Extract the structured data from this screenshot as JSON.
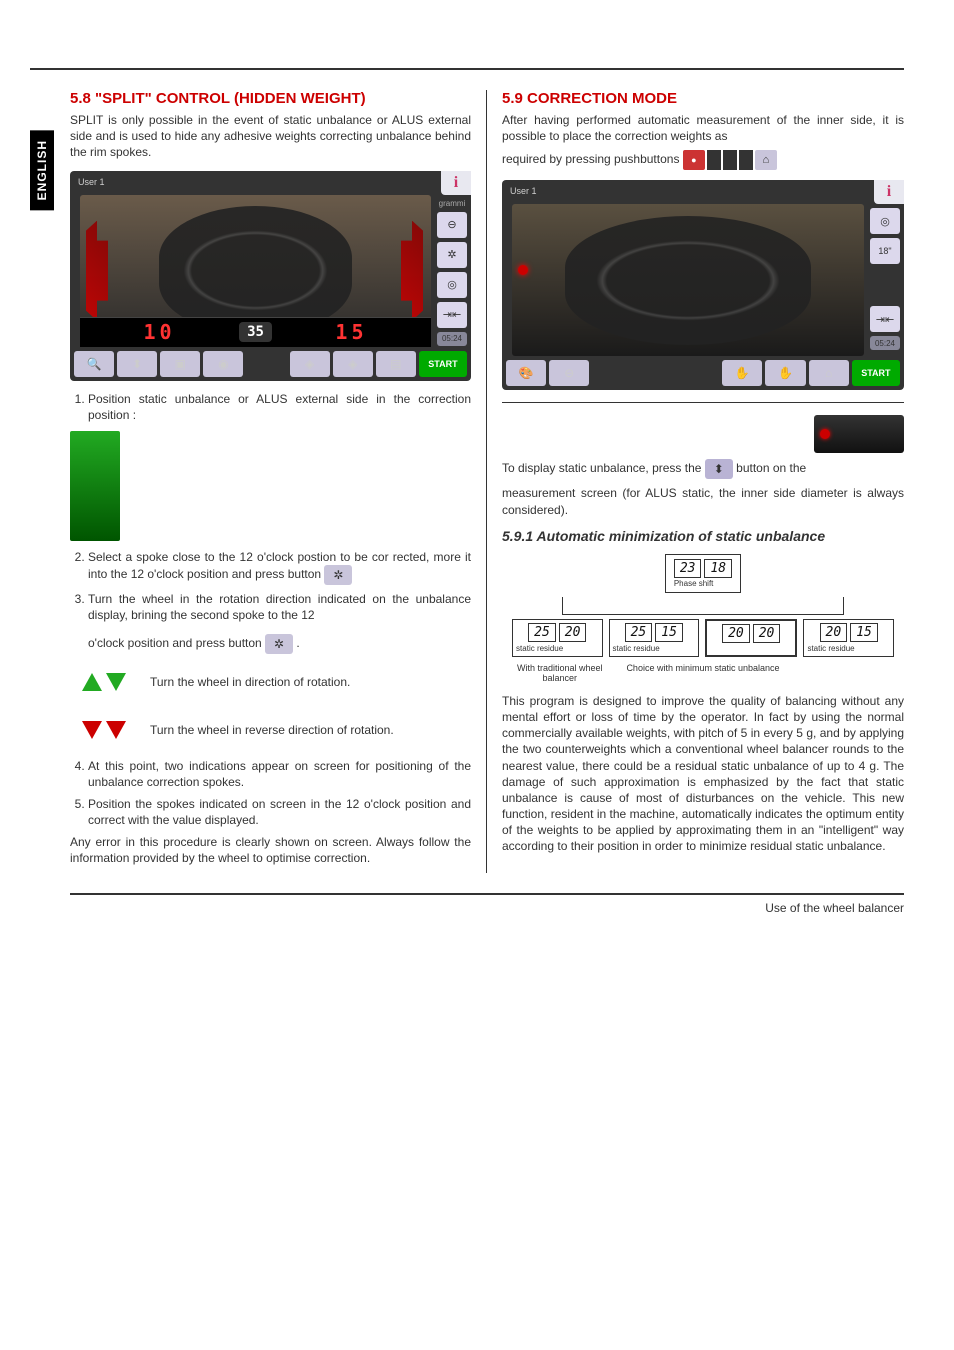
{
  "side_tab": "ENGLISH",
  "left": {
    "h2": "5.8    \"SPLIT\" CONTROL (HIDDEN WEIGHT)",
    "intro": "SPLIT is only possible in the event of static unbalance or ALUS external side and is used to hide any adhesive weights correcting unbalance behind the rim spokes.",
    "screen": {
      "user": "User 1",
      "info": "i",
      "side_label": "grammi",
      "val_left": "10",
      "val_mid": "35",
      "val_right": "15",
      "clock": "05:24",
      "start": "START"
    },
    "step1": "Position static unbalance or ALUS external side in the correction position :",
    "step2": "Select a spoke close to the 12 o'clock postion to be cor rected, more it into the 12 o'clock position and press button",
    "step3a": "Turn the wheel in the rotation direction indicated on the unbalance display, brining the second spoke to the 12",
    "step3b": "o'clock position and press button",
    "rot_fwd": "Turn the wheel in direction of rotation.",
    "rot_rev": "Turn the wheel in reverse direction of rotation.",
    "step4": "At this point, two indications appear on screen for positioning of the unbalance correction spokes.",
    "step5": "Position the spokes indicated on screen in the 12 o'clock position and correct with the value displayed.",
    "note": "Any error in this procedure is clearly shown on screen. Always follow the information provided by the wheel to optimise correction."
  },
  "right": {
    "h2": "5.9    CORRECTION MODE",
    "intro1": "After having performed automatic measurement of the inner side, it is possible to place the correction weights as",
    "intro2": "required by pressing pushbuttons",
    "screen": {
      "user": "User 1",
      "info": "i",
      "side_18": "18\"",
      "clock": "05:24",
      "start": "START"
    },
    "static_line1": "To display static unbalance, press the",
    "static_line2": "button on the",
    "static_line3": "measurement screen (for ALUS static, the inner side diameter is always considered).",
    "h3": "5.9.1   Automatic minimization of static unbalance",
    "chart_data": {
      "type": "diagram",
      "top": {
        "values": [
          "23",
          "18"
        ],
        "label": "Phase shift"
      },
      "options": [
        {
          "values": [
            "25",
            "20"
          ],
          "label": "static residue",
          "caption": "With traditional wheel balancer"
        },
        {
          "values": [
            "25",
            "15"
          ],
          "label": "static residue",
          "caption": ""
        },
        {
          "values": [
            "20",
            "20"
          ],
          "label": "",
          "caption": "Choice with minimum static unbalance"
        },
        {
          "values": [
            "20",
            "15"
          ],
          "label": "static residue",
          "caption": ""
        }
      ]
    },
    "body": "This program is designed to improve the quality of balancing without any mental effort or loss of time by the operator. In fact by using the normal commercially available weights, with pitch of 5 in every 5 g, and by applying the two counterweights which a conventional wheel balancer rounds to the nearest value, there could be a residual static unbalance of up to 4 g. The damage of such approximation is emphasized by the fact that static unbalance is cause of most of disturbances on the vehicle. This new function, resident in the machine, automatically indicates the optimum entity of the weights to be applied by approximating them in an \"intelligent\" way according to their position in order to minimize residual static unbalance."
  },
  "footer": "Use of the wheel balancer"
}
